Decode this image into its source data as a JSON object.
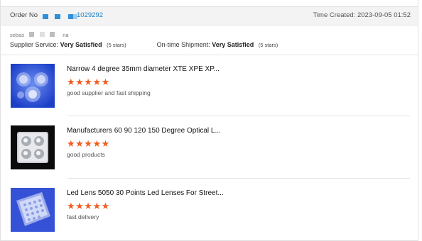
{
  "order": {
    "label": "Order No",
    "number_visible": "1029292",
    "time_label": "Time Created:",
    "time_value": "2023-09-05 01:52"
  },
  "buyer": {
    "name_start": "sebas",
    "name_end": "na"
  },
  "service": {
    "supplier_label": "Supplier Service:",
    "supplier_value": "Very Satisfied",
    "supplier_stars": "(5 stars)",
    "shipment_label": "On-time Shipment:",
    "shipment_value": "Very Satisfied",
    "shipment_stars": "(5 stars)"
  },
  "items": [
    {
      "title": "Narrow 4 degree 35mm diameter XTE XPE XP...",
      "stars": "★★★★★",
      "rating": 5,
      "review": "good supplier and fast shipping",
      "thumb_icon": "clear-led-lens-cluster-icon"
    },
    {
      "title": "Manufacturers 60 90 120 150 Degree Optical L...",
      "stars": "★★★★★",
      "rating": 5,
      "review": "good products",
      "thumb_icon": "square-4-lens-array-icon"
    },
    {
      "title": "Led Lens 5050 30 Points Led Lenses For Street...",
      "stars": "★★★★★",
      "rating": 5,
      "review": "fast delivery",
      "thumb_icon": "street-light-lens-panel-icon"
    }
  ],
  "colors": {
    "link_blue": "#1a7fc7",
    "star_orange": "#f15c21",
    "mask_blue": "#2f8fd8",
    "mask_gray": "#bdbdbd"
  }
}
